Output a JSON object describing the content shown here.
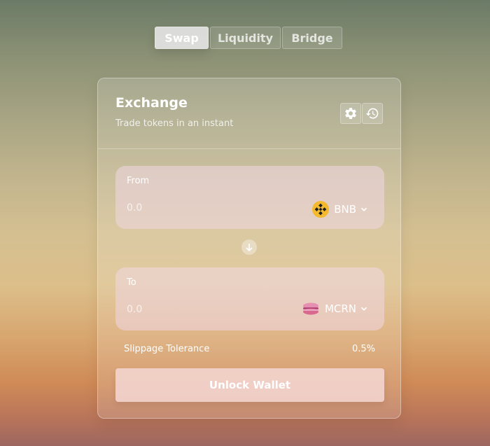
{
  "tabs": [
    {
      "label": "Swap",
      "active": true
    },
    {
      "label": "Liquidity",
      "active": false
    },
    {
      "label": "Bridge",
      "active": false
    }
  ],
  "card": {
    "title": "Exchange",
    "subtitle": "Trade tokens in an instant",
    "header_icons": [
      "gear-icon",
      "history-icon"
    ]
  },
  "from": {
    "label": "From",
    "placeholder": "0.0",
    "token": {
      "symbol": "BNB",
      "icon": "bnb-icon",
      "color": "#f3ba2f"
    }
  },
  "to": {
    "label": "To",
    "placeholder": "0.0",
    "token": {
      "symbol": "MCRN",
      "icon": "mcrn-icon",
      "color": "#d9698f"
    }
  },
  "slippage": {
    "label": "Slippage Tolerance",
    "value": "0.5%"
  },
  "unlock_button": {
    "label": "Unlock Wallet"
  }
}
